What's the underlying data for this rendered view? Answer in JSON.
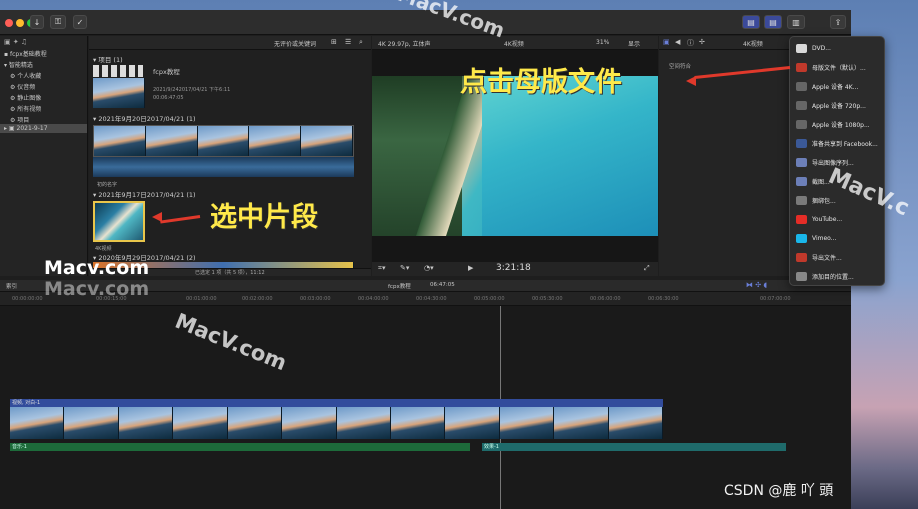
{
  "toolbar": {
    "library_title": "fcpx基础教程",
    "keyword_filter": "无评价或关键词",
    "clip_info": "4K 29.97p, 立体声",
    "viewer_clip": "4K视频",
    "zoom": "31%",
    "view_menu": "显示",
    "inspector_clip": "4K视频",
    "space": "空间符合"
  },
  "sidebar": {
    "items": [
      {
        "label": "fcpx基础教程"
      },
      {
        "label": "智能精选"
      },
      {
        "label": "个人收藏"
      },
      {
        "label": "仪音频"
      },
      {
        "label": "静止图像"
      },
      {
        "label": "所有视频"
      },
      {
        "label": "项目"
      },
      {
        "label": "2021-9-17"
      }
    ]
  },
  "browser": {
    "projects_header": "项目",
    "projects_count": "(1)",
    "project_name": "fcpx教程",
    "project_date": "2021/9/242017/04/21 下午6:11",
    "project_duration": "00:06:47:05",
    "group1": "2021年9月20日2017/04/21",
    "group1_count": "(1)",
    "group2_caption": "初的名字",
    "group2": "2021年9月17日2017/04/21",
    "group2_count": "(1)",
    "clip_label": "4K视频",
    "group3": "2020年9月29日2017/04/21",
    "group3_count": "(2)",
    "status": "已选定 1 项（共 5 项），11:12"
  },
  "viewer": {
    "timecode": "3:21:18"
  },
  "timeline": {
    "index_tab": "索引",
    "project": "fcpx教程",
    "duration": "06:47:05",
    "ticks": [
      "00:00:00:00",
      "00:00:15:00",
      "00:01:00:00",
      "00:02:00:00",
      "00:03:00:00",
      "00:04:00:00",
      "00:04:30:00",
      "00:05:00:00",
      "00:05:30:00",
      "00:06:00:00",
      "00:06:30:00",
      "00:07:00:00"
    ],
    "clip_name": "视频, 对白-1",
    "audio1": "音乐-1",
    "audio2": "效果-1"
  },
  "share_menu": {
    "items": [
      {
        "label": "DVD...",
        "icon": "dvd-icon",
        "color": "#d9d9d9"
      },
      {
        "label": "母版文件（默认）...",
        "icon": "master-file-icon",
        "color": "#c0392b"
      },
      {
        "label": "Apple 设备 4K...",
        "icon": "device-icon",
        "color": "#666666"
      },
      {
        "label": "Apple 设备 720p...",
        "icon": "device-icon",
        "color": "#666666"
      },
      {
        "label": "Apple 设备 1080p...",
        "icon": "device-icon",
        "color": "#666666"
      },
      {
        "label": "准备共享到 Facebook...",
        "icon": "facebook-icon",
        "color": "#3b5998"
      },
      {
        "label": "导出图像序列...",
        "icon": "image-sequence-icon",
        "color": "#6c7fb8"
      },
      {
        "label": "截图...",
        "icon": "screenshot-icon",
        "color": "#6c7fb8"
      },
      {
        "label": "捆绑包...",
        "icon": "bundle-icon",
        "color": "#7a7a7a"
      },
      {
        "label": "YouTube...",
        "icon": "youtube-icon",
        "color": "#e52d27"
      },
      {
        "label": "Vimeo...",
        "icon": "vimeo-icon",
        "color": "#1ab7ea"
      },
      {
        "label": "导出文件...",
        "icon": "export-file-icon",
        "color": "#c0392b"
      },
      {
        "label": "添加目的位置...",
        "icon": "add-destination-icon",
        "color": "#888888"
      }
    ]
  },
  "annotations": {
    "master": "点击母版文件",
    "select": "选中片段"
  },
  "watermarks": {
    "macv_upper": "MacV.com",
    "macv_right": "MacV.c",
    "macv_left": "Macv.com",
    "macv_left2": "Macv.com",
    "macv_mid": "MacV.com",
    "credit": "CSDN @鹿 吖 頭 "
  }
}
